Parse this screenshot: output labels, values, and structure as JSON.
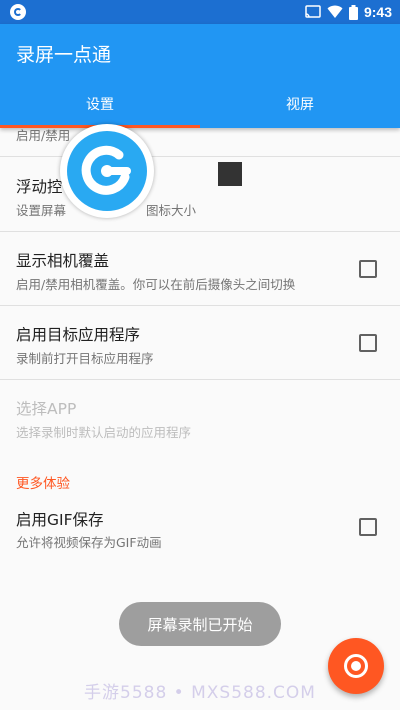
{
  "status_bar": {
    "time": "9:43"
  },
  "app_bar": {
    "title": "录屏一点通"
  },
  "tabs": [
    {
      "label": "设置",
      "active": true
    },
    {
      "label": "视屏",
      "active": false
    }
  ],
  "prefs": {
    "partial": {
      "summary": "启用/禁用"
    },
    "floating": {
      "title": "浮动控",
      "summary": "设置屏幕",
      "summary_tail": "图标大小"
    },
    "camera": {
      "title": "显示相机覆盖",
      "summary": "启用/禁用相机覆盖。你可以在前后摄像头之间切换",
      "checked": false
    },
    "target_app": {
      "title": "启用目标应用程序",
      "summary": "录制前打开目标应用程序",
      "checked": false
    },
    "choose_app": {
      "title": "选择APP",
      "summary": "选择录制时默认启动的应用程序",
      "enabled": false
    },
    "section_more": "更多体验",
    "gif": {
      "title": "启用GIF保存",
      "summary": "允许将视频保存为GIF动画",
      "checked": false
    }
  },
  "toast": "屏幕录制已开始",
  "watermark": "手游5588 • MXS588.COM",
  "colors": {
    "primary": "#2196f3",
    "accent": "#ff5722",
    "status_bar": "#1c6fd1"
  },
  "icons": {
    "fab": "record-icon",
    "bubble": "floating-control-icon"
  }
}
